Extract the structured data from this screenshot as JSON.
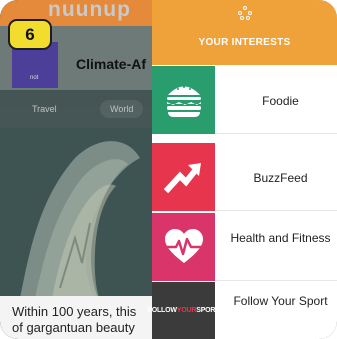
{
  "step_badge": "6",
  "background_article": {
    "site_logo": "nuunup",
    "thumb_label": "not",
    "title": "Climate-Af",
    "tabs": [
      "Travel",
      "World"
    ],
    "caption_line1": "Within 100 years, this",
    "caption_line2": "of gargantuan beauty"
  },
  "drawer": {
    "header_title": "YOUR INTERESTS",
    "header_color": "#f0a23a",
    "items": [
      {
        "label": "Foodie",
        "icon": "burger-icon",
        "color": "#2a9d6f"
      },
      {
        "label": "BuzzFeed",
        "icon": "trending-arrow-icon",
        "color": "#e8354e"
      },
      {
        "label": "Health and Fitness",
        "icon": "heart-pulse-icon",
        "color": "#d9356a"
      },
      {
        "label": "Follow Your Sport",
        "icon": "follow-your-sport-logo",
        "logo_text_a": "FOLLOW",
        "logo_text_b": "YOUR",
        "logo_text_c": "SPORT",
        "color": "#3b3b3b"
      }
    ]
  }
}
